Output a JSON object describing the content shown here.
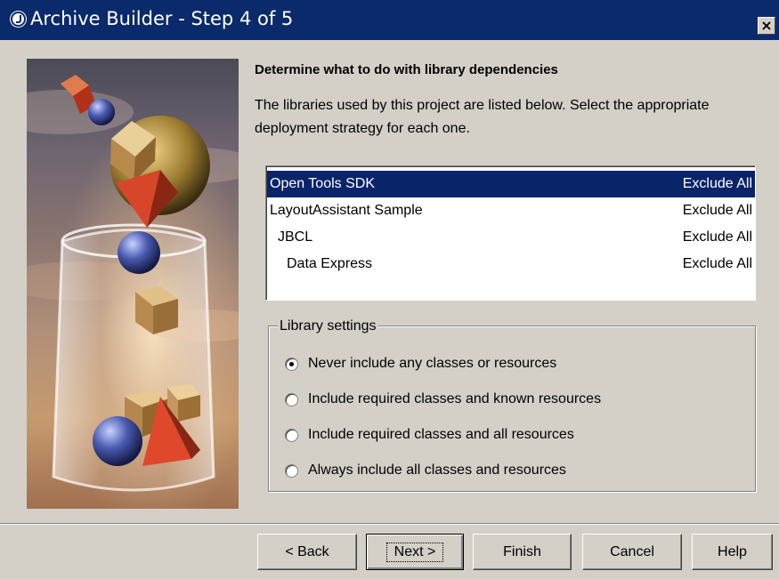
{
  "window": {
    "title": "Archive Builder - Step 4 of 5",
    "close_glyph": "×",
    "title_icon": "jbuilder-logo-icon",
    "titlebar_color": "#0a2a6b"
  },
  "main": {
    "heading": "Determine what to do with library dependencies",
    "description": "The libraries used by this project are listed below. Select the appropriate deployment strategy for each one."
  },
  "libraries": [
    {
      "name": "Open Tools SDK",
      "strategy": "Exclude All",
      "selected": true
    },
    {
      "name": "LayoutAssistant Sample",
      "strategy": "Exclude All",
      "selected": false
    },
    {
      "name": "JBCL",
      "strategy": "Exclude All",
      "selected": false
    },
    {
      "name": "Data Express",
      "strategy": "Exclude All",
      "selected": false
    }
  ],
  "library_settings": {
    "legend": "Library settings",
    "options": [
      {
        "label": "Never include any classes or resources",
        "checked": true
      },
      {
        "label": "Include required classes and known resources",
        "checked": false
      },
      {
        "label": "Include required classes and all resources",
        "checked": false
      },
      {
        "label": "Always include all classes and resources",
        "checked": false
      }
    ]
  },
  "buttons": {
    "back": "< Back",
    "next": "Next >",
    "finish": "Finish",
    "cancel": "Cancel",
    "help": "Help"
  },
  "colors": {
    "selection": "#0a246a",
    "dialog_bg": "#d4d0c8"
  }
}
